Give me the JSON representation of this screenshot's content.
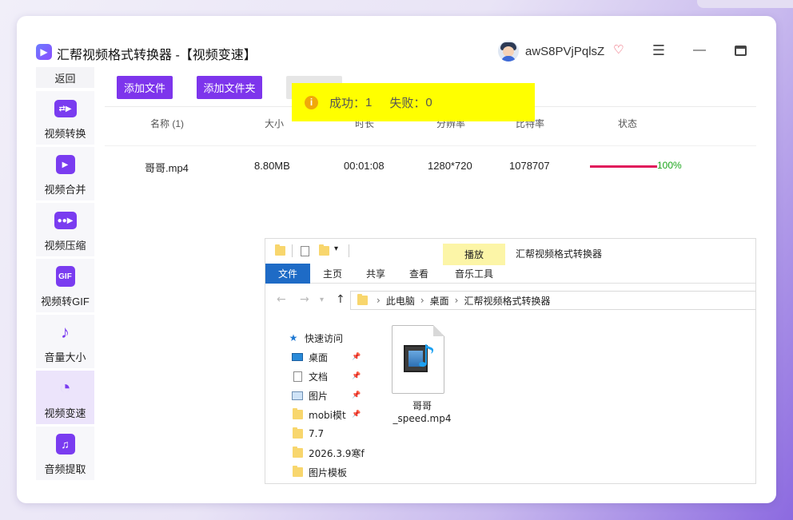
{
  "app": {
    "title": "汇帮视频格式转换器 -【视频变速】",
    "logo_icon": "play-icon",
    "user_name": "awS8PVjPqlsZ",
    "vip_icon": "heart-vip-icon"
  },
  "sidebar": {
    "back_label": "返回",
    "items": [
      {
        "label": "视频转换",
        "icon": "video-convert-icon"
      },
      {
        "label": "视频合并",
        "icon": "video-merge-icon"
      },
      {
        "label": "视频压缩",
        "icon": "video-compress-icon"
      },
      {
        "label": "视频转GIF",
        "icon": "gif-icon"
      },
      {
        "label": "音量大小",
        "icon": "music-note-icon"
      },
      {
        "label": "视频变速",
        "icon": "speedometer-icon",
        "active": true
      },
      {
        "label": "音频提取",
        "icon": "audio-extract-icon"
      }
    ]
  },
  "toolbar": {
    "add_file": "添加文件",
    "add_folder": "添加文件夹"
  },
  "table": {
    "headers": [
      "名称 (1)",
      "大小",
      "时长",
      "分辨率",
      "比特率",
      "状态"
    ],
    "rows": [
      {
        "name": "哥哥.mp4",
        "size": "8.80MB",
        "duration": "00:01:08",
        "resolution": "1280*720",
        "bitrate": "1078707",
        "progress": 1.0,
        "status": "100%"
      }
    ]
  },
  "toast": {
    "success_label": "成功：",
    "success_count": "1",
    "fail_label": "失败：",
    "fail_count": "0",
    "color": "#ffff00"
  },
  "explorer": {
    "tabs": [
      "文件",
      "主页",
      "共享",
      "查看",
      "音乐工具"
    ],
    "context_tab": "播放",
    "window_title": "汇帮视频格式转换器",
    "breadcrumb": [
      "此电脑",
      "桌面",
      "汇帮视频格式转换器"
    ],
    "tree": [
      {
        "label": "快速访问",
        "icon": "star-icon"
      },
      {
        "label": "桌面",
        "icon": "desktop-icon",
        "pinned": true
      },
      {
        "label": "文档",
        "icon": "document-icon",
        "pinned": true
      },
      {
        "label": "图片",
        "icon": "picture-icon",
        "pinned": true
      },
      {
        "label": "mobi模t",
        "icon": "folder-icon",
        "pinned": true
      },
      {
        "label": "7.7",
        "icon": "folder-icon"
      },
      {
        "label": "2026.3.9寒f",
        "icon": "folder-icon"
      },
      {
        "label": "图片模板",
        "icon": "folder-icon"
      }
    ],
    "file": {
      "name_line1": "哥哥",
      "name_line2": "_speed.mp4",
      "icon": "media-file-icon"
    }
  },
  "colors": {
    "accent": "#7d35ec",
    "progress": "#e0145a",
    "status_text": "#1aa51a"
  }
}
